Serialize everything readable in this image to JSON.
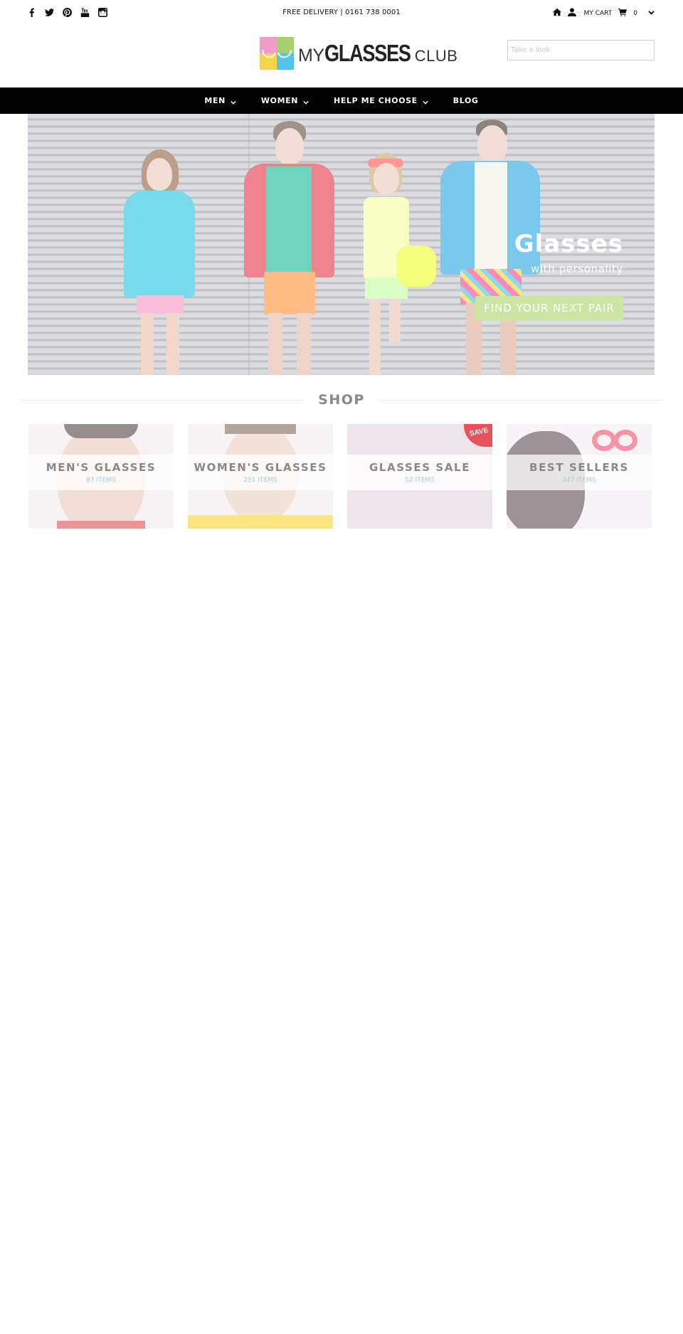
{
  "topbar": {
    "social_icons": [
      "facebook-icon",
      "twitter-icon",
      "pinterest-icon",
      "youtube-icon",
      "instagram-icon"
    ],
    "delivery_text": "FREE DELIVERY | 0161 738 0001",
    "cart_label": "MY CART",
    "cart_count": "0"
  },
  "header": {
    "logo": {
      "my": "MY",
      "glasses": "GLASSES",
      "club": "CLUB"
    },
    "search_placeholder": "Take a look"
  },
  "nav": {
    "items": [
      {
        "label": "MEN",
        "has_dropdown": true
      },
      {
        "label": "WOMEN",
        "has_dropdown": true
      },
      {
        "label": "HELP ME CHOOSE",
        "has_dropdown": true
      },
      {
        "label": "BLOG",
        "has_dropdown": false
      }
    ]
  },
  "hero": {
    "title": "Glasses",
    "subtitle": "with personality",
    "cta": "FIND YOUR NEXT PAIR",
    "cta_color": "#cde5a3"
  },
  "shop": {
    "heading": "SHOP",
    "tiles": [
      {
        "name": "MEN'S GLASSES",
        "count": "87 ITEMS"
      },
      {
        "name": "WOMEN'S GLASSES",
        "count": "251 ITEMS"
      },
      {
        "name": "GLASSES SALE",
        "count": "52 ITEMS",
        "badge": "SAVE"
      },
      {
        "name": "BEST SELLERS",
        "count": "247 ITEMS"
      }
    ]
  },
  "colors": {
    "nav_background": "#000000",
    "tile_count": "#9dd0e4",
    "badge": "#e8535a"
  }
}
